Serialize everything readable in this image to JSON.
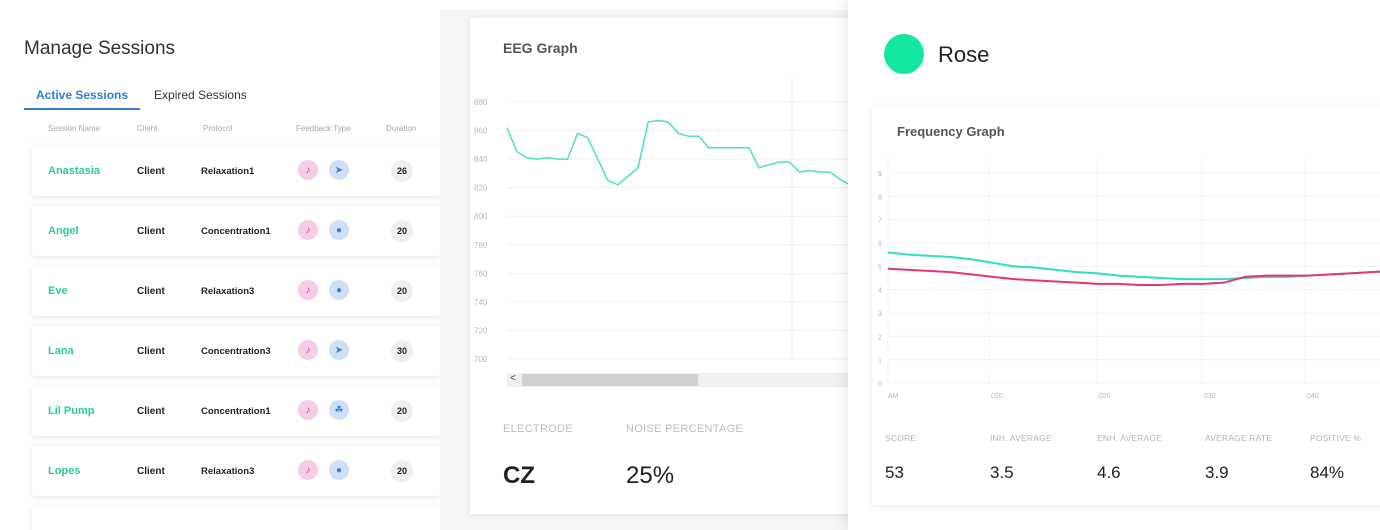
{
  "sessions": {
    "title": "Manage Sessions",
    "tabs": [
      {
        "label": "Active Sessions",
        "active": true
      },
      {
        "label": "Expired Sessions",
        "active": false
      }
    ],
    "columns": [
      "Session Name",
      "Client",
      "Protocol",
      "Feedback Type",
      "Duration"
    ],
    "rows": [
      {
        "name": "Anastasia",
        "client": "Client",
        "protocol": "Relaxation1",
        "icons": [
          "music-note-icon",
          "rocket-icon"
        ],
        "duration": "26"
      },
      {
        "name": "Angel",
        "client": "Client",
        "protocol": "Concentration1",
        "icons": [
          "music-note-icon",
          "water-drop-icon"
        ],
        "duration": "20"
      },
      {
        "name": "Eve",
        "client": "Client",
        "protocol": "Relaxation3",
        "icons": [
          "music-note-icon",
          "water-drop-icon"
        ],
        "duration": "20"
      },
      {
        "name": "Lana",
        "client": "Client",
        "protocol": "Concentration3",
        "icons": [
          "music-note-icon",
          "rocket-icon"
        ],
        "duration": "30"
      },
      {
        "name": "Lil Pump",
        "client": "Client",
        "protocol": "Concentration1",
        "icons": [
          "music-note-icon",
          "leaf-icon"
        ],
        "duration": "20"
      },
      {
        "name": "Lopes",
        "client": "Client",
        "protocol": "Relaxation3",
        "icons": [
          "music-note-icon",
          "water-drop-icon"
        ],
        "duration": "20"
      }
    ]
  },
  "eeg": {
    "title": "EEG Graph",
    "y_ticks": [
      "880",
      "860",
      "840",
      "820",
      "800",
      "780",
      "760",
      "740",
      "720",
      "700"
    ],
    "scroll_left_arrow": "<",
    "electrode_label": "ELECTRODE",
    "electrode_value": "CZ",
    "noise_label": "NOISE PERCENTAGE",
    "noise_value": "25%",
    "line_color": "#4ee0c0"
  },
  "profile": {
    "name": "Rose",
    "color": "#12e8a0"
  },
  "frequency": {
    "title": "Frequency Graph",
    "y_ticks": [
      "0",
      "1",
      "2",
      "3",
      "4",
      "5",
      "6",
      "7",
      "8",
      "9"
    ],
    "x_ticks": [
      "AM",
      ".010",
      ".020",
      ".030",
      ".040"
    ],
    "stats": [
      {
        "label": "SCORE",
        "value": "53"
      },
      {
        "label": "INH. AVERAGE",
        "value": "3.5"
      },
      {
        "label": "ENH. AVERAGE",
        "value": "4.6"
      },
      {
        "label": "AVERAGE RATE",
        "value": "3.9"
      },
      {
        "label": "POSITIVE %",
        "value": "84%"
      }
    ],
    "series_colors": {
      "enhance": "#2ee0bd",
      "inhibit": "#e8356a"
    }
  },
  "chart_data": [
    {
      "type": "line",
      "title": "EEG Graph",
      "ylim": [
        700,
        880
      ],
      "x": [
        0,
        1,
        2,
        3,
        4,
        5,
        6,
        7,
        8,
        9,
        10,
        11,
        12,
        13,
        14,
        15,
        16,
        17,
        18,
        19,
        20,
        21,
        22,
        23,
        24,
        25,
        26,
        27,
        28,
        29,
        30,
        31,
        32,
        33,
        34,
        35,
        36
      ],
      "values": [
        862,
        845,
        841,
        840,
        841,
        840,
        840,
        858,
        855,
        840,
        825,
        822,
        828,
        834,
        866,
        867,
        866,
        858,
        856,
        856,
        848,
        848,
        848,
        848,
        848,
        834,
        836,
        838,
        838,
        831,
        832,
        831,
        831,
        826,
        822,
        820,
        820
      ]
    },
    {
      "type": "line",
      "title": "Frequency Graph",
      "ylim": [
        0,
        9
      ],
      "x_ticks": [
        "AM",
        ".010",
        ".020",
        ".030",
        ".040"
      ],
      "x": [
        0,
        1,
        2,
        3,
        4,
        5,
        6,
        7,
        8,
        9,
        10,
        11,
        12,
        13,
        14,
        15,
        16,
        17,
        18,
        19,
        20,
        21,
        22,
        23,
        24
      ],
      "series": [
        {
          "values": [
            5.6,
            5.5,
            5.45,
            5.4,
            5.3,
            5.15,
            5.0,
            4.95,
            4.85,
            4.75,
            4.7,
            4.6,
            4.55,
            4.5,
            4.45,
            4.45,
            4.45,
            4.5,
            4.55,
            4.55,
            4.6,
            4.65,
            4.7,
            4.75,
            4.8
          ]
        },
        {
          "values": [
            4.9,
            4.85,
            4.8,
            4.75,
            4.65,
            4.55,
            4.45,
            4.4,
            4.35,
            4.3,
            4.25,
            4.25,
            4.2,
            4.2,
            4.25,
            4.25,
            4.3,
            4.55,
            4.6,
            4.6,
            4.6,
            4.65,
            4.7,
            4.75,
            4.8
          ]
        }
      ]
    }
  ]
}
